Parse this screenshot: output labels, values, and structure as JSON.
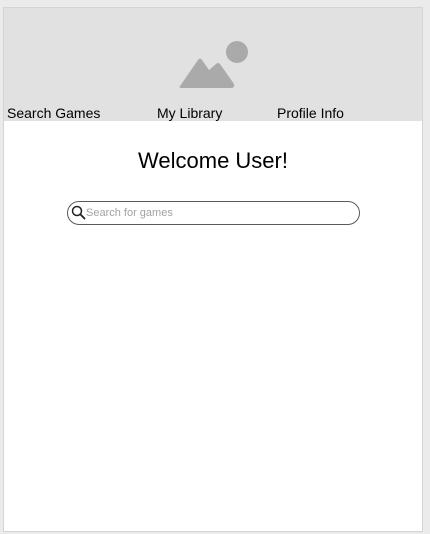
{
  "nav": {
    "items": [
      {
        "label": "Search Games"
      },
      {
        "label": "My Library"
      },
      {
        "label": "Profile Info"
      }
    ]
  },
  "header": {
    "image_icon": "image-placeholder-icon"
  },
  "main": {
    "welcome_text": "Welcome User!"
  },
  "search": {
    "placeholder": "Search for games",
    "value": "",
    "icon": "search-icon"
  },
  "colors": {
    "header_background": "#e1e1e1",
    "image_placeholder": "#aaaaaa"
  }
}
